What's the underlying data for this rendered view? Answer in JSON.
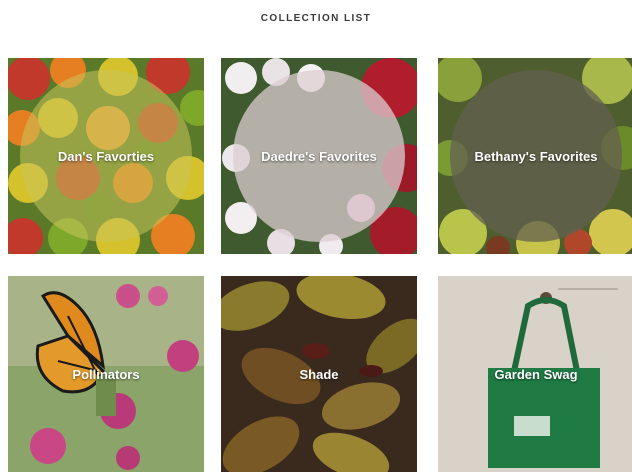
{
  "page": {
    "heading": "COLLECTION LIST"
  },
  "collections": [
    {
      "title": "Dan's Favorties",
      "overlay_color": "#c9c45a",
      "has_circle": true
    },
    {
      "title": "Daedre's Favorites",
      "overlay_color": "#d8c8cc",
      "has_circle": true
    },
    {
      "title": "Bethany's Favorites",
      "overlay_color": "#6b6b52",
      "has_circle": true
    },
    {
      "title": "Pollinators",
      "has_circle": false
    },
    {
      "title": "Shade",
      "has_circle": false
    },
    {
      "title": "Garden Swag",
      "has_circle": false
    }
  ]
}
